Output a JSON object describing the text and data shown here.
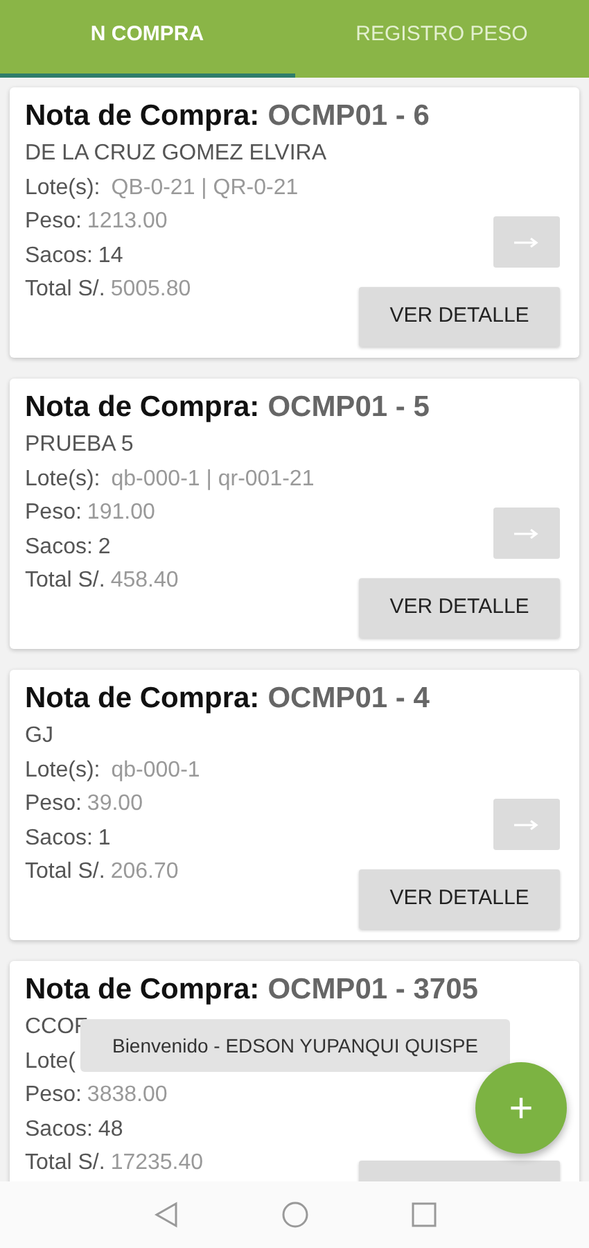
{
  "tabs": [
    {
      "label": "N COMPRA",
      "selected": true
    },
    {
      "label": "REGISTRO PESO",
      "selected": false
    }
  ],
  "cards": [
    {
      "title_label": "Nota de Compra:",
      "number": "OCMP01 - 6",
      "name": "DE LA CRUZ GOMEZ ELVIRA",
      "lots_label": "Lote(s):",
      "lots": "QB-0-21 | QR-0-21",
      "weight_label": "Peso:",
      "weight": "1213.00",
      "sacks_label": "Sacos:",
      "sacks": "14",
      "total_label": "Total S/.",
      "total": "5005.80",
      "arrow_button": true,
      "detail_button": "VER DETALLE"
    },
    {
      "title_label": "Nota de Compra:",
      "number": "OCMP01 - 5",
      "name": "PRUEBA 5",
      "lots_label": "Lote(s):",
      "lots": "qb-000-1 | qr-001-21",
      "weight_label": "Peso:",
      "weight": "191.00",
      "sacks_label": "Sacos:",
      "sacks": "2",
      "total_label": "Total S/.",
      "total": "458.40",
      "arrow_button": true,
      "detail_button": "VER DETALLE"
    },
    {
      "title_label": "Nota de Compra:",
      "number": "OCMP01 - 4",
      "name": "GJ",
      "lots_label": "Lote(s):",
      "lots": "qb-000-1",
      "weight_label": "Peso:",
      "weight": "39.00",
      "sacks_label": "Sacos:",
      "sacks": "1",
      "total_label": "Total S/.",
      "total": "206.70",
      "arrow_button": true,
      "detail_button": "VER DETALLE"
    },
    {
      "title_label": "Nota de Compra:",
      "number": "OCMP01 - 3705",
      "name": "CCOF",
      "lots_label": "Lote(",
      "weight_label": "Peso:",
      "weight": "3838.00",
      "sacks_label": "Sacos:",
      "sacks": "48",
      "total_label": "Total S/.",
      "total": "17235.40",
      "arrow_button": false
    }
  ],
  "toast": "Bienvenido - EDSON YUPANQUI QUISPE",
  "fab": "+"
}
